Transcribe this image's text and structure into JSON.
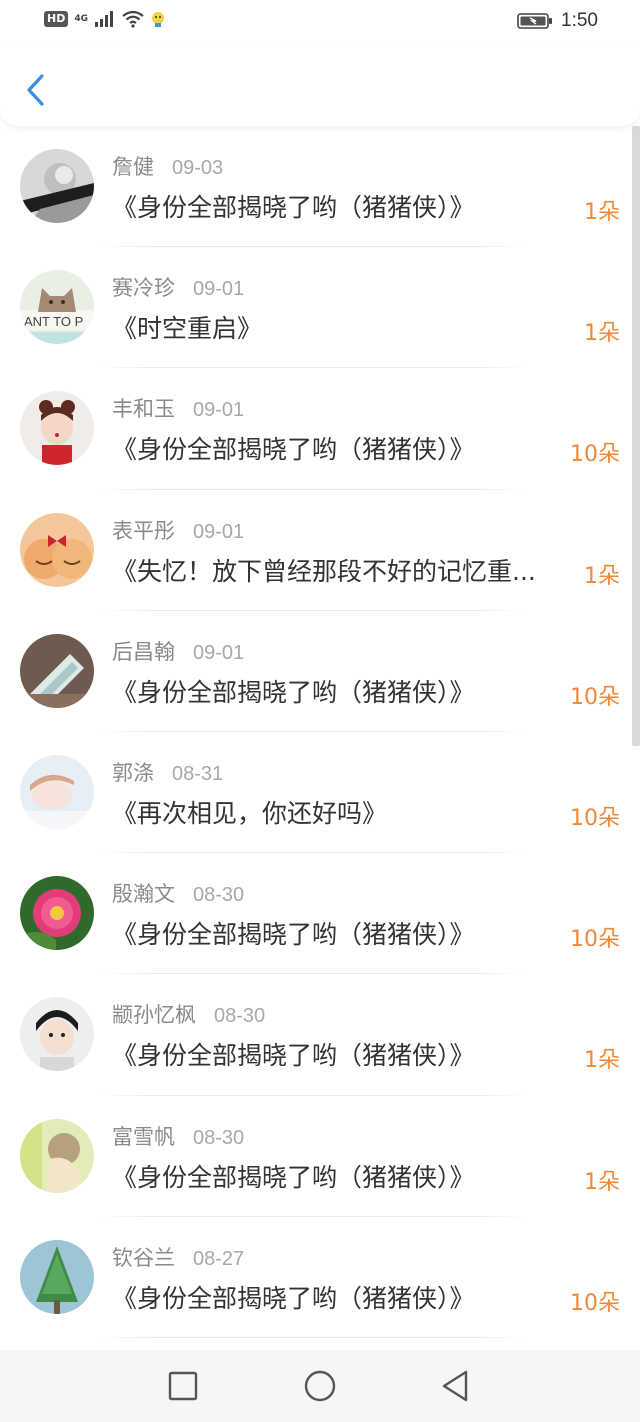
{
  "status_bar": {
    "hd_badge": "HD",
    "network": "4G",
    "clock": "1:50"
  },
  "icons": {
    "back": "chevron-left-icon",
    "signal": "signal-icon",
    "wifi": "wifi-icon",
    "battery": "battery-icon"
  },
  "colors": {
    "accent_blue": "#3a8ee6",
    "count_orange": "#f0883a",
    "name_gray": "#8a8a8a",
    "title_dark": "#333333"
  },
  "items": [
    {
      "name": "詹健",
      "date": "09-03",
      "title": "《身份全部揭晓了哟（猪猪侠）》",
      "count": "1朵"
    },
    {
      "name": "赛冷珍",
      "date": "09-01",
      "title": "《时空重启》",
      "count": "1朵"
    },
    {
      "name": "丰和玉",
      "date": "09-01",
      "title": "《身份全部揭晓了哟（猪猪侠）》",
      "count": "10朵"
    },
    {
      "name": "表平彤",
      "date": "09-01",
      "title": "《失忆！放下曾经那段不好的记忆重...",
      "count": "1朵"
    },
    {
      "name": "后昌翰",
      "date": "09-01",
      "title": "《身份全部揭晓了哟（猪猪侠）》",
      "count": "10朵"
    },
    {
      "name": "郭涤",
      "date": "08-31",
      "title": "《再次相见，你还好吗》",
      "count": "10朵"
    },
    {
      "name": "殷瀚文",
      "date": "08-30",
      "title": "《身份全部揭晓了哟（猪猪侠）》",
      "count": "10朵"
    },
    {
      "name": "颛孙忆枫",
      "date": "08-30",
      "title": "《身份全部揭晓了哟（猪猪侠）》",
      "count": "1朵"
    },
    {
      "name": "富雪帆",
      "date": "08-30",
      "title": "《身份全部揭晓了哟（猪猪侠）》",
      "count": "1朵"
    },
    {
      "name": "钦谷兰",
      "date": "08-27",
      "title": "《身份全部揭晓了哟（猪猪侠）》",
      "count": "10朵"
    }
  ]
}
